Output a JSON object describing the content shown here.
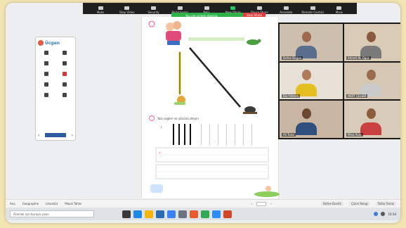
{
  "toolbar": {
    "items": [
      {
        "label": "Mute",
        "icon": "microphone-icon"
      },
      {
        "label": "Stop Video",
        "icon": "video-camera-icon"
      },
      {
        "label": "Security",
        "icon": "shield-icon"
      },
      {
        "label": "Participants",
        "icon": "participants-icon"
      },
      {
        "label": "Polls",
        "icon": "poll-icon"
      },
      {
        "label": "New Share",
        "icon": "share-screen-icon"
      },
      {
        "label": "Pause Share",
        "icon": "pause-icon"
      },
      {
        "label": "Annotate",
        "icon": "pencil-icon"
      },
      {
        "label": "Remote Control",
        "icon": "remote-control-icon"
      },
      {
        "label": "More",
        "icon": "more-icon"
      }
    ]
  },
  "share_banner": {
    "text": "You are screen sharing",
    "stop_label": "Stop Share"
  },
  "worksheet": {
    "instruction": "Yazı ceğiler ve yönünü izleyin"
  },
  "participants": [
    {
      "name": "Defne Doğan"
    },
    {
      "name": "Ahmet Ali Öğüt"
    },
    {
      "name": "Ela Yıldırım"
    },
    {
      "name": "MERT ÇELEBİ"
    },
    {
      "name": "Ali Tuna"
    },
    {
      "name": "Mina Acar"
    }
  ],
  "status_bar": {
    "left_items": [
      "Ana",
      "Geographie",
      "Literatür",
      "Masal Tahta"
    ],
    "right_items": [
      "Defne Dershi",
      "Çizim Rengi",
      "Tahta Temiz"
    ]
  },
  "taskbar": {
    "search_placeholder": "Aramak için buraya yazın",
    "clock": "10:34"
  },
  "colors": {
    "zoom_bar": "#1f1f1f",
    "share_banner": "#2fb24a",
    "stop_button": "#e23b3b",
    "desktop_frame": "#f3e4b3"
  }
}
